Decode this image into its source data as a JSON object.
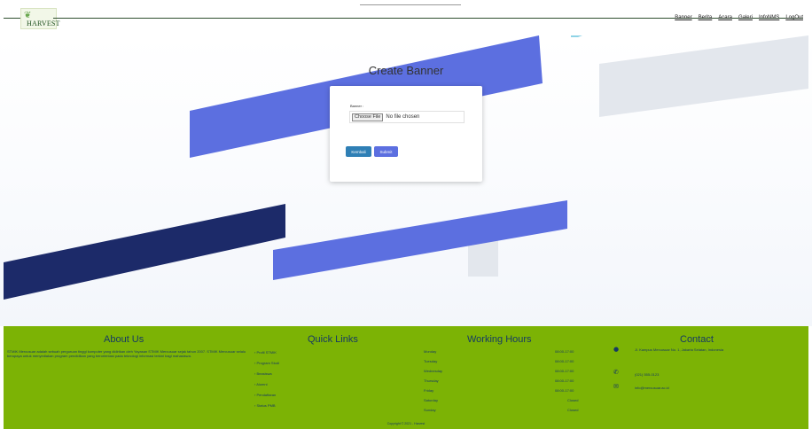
{
  "header": {
    "logo_text": "HARVEST",
    "nav": [
      "Banner",
      "Berita",
      "Acara",
      "Galeri",
      "InfoNMS",
      "LogOut"
    ]
  },
  "page": {
    "title": "Create Banner",
    "form": {
      "label": "Banner :",
      "choose_file_label": "Choose File",
      "file_status": "No file chosen",
      "buttons": [
        "Kembali",
        "Submit"
      ]
    }
  },
  "footer": {
    "about": {
      "title": "About Us",
      "text": "STMIK Mercusuar adalah sebuah perguruan tinggi komputer yang didirikan oleh Yayasan STMIK Mercusuar sejak tahun 2007. STMIK Mercusuar selalu berupaya untuk menyediakan program pendidikan yang berorientasi pada teknologi informasi terkini bagi mahasiswa."
    },
    "quick_links": {
      "title": "Quick Links",
      "items": [
        "Profil STMIK",
        "Program Studi",
        "Beasiswa",
        "Alumni",
        "Pendaftaran",
        "Status PMB"
      ]
    },
    "working_hours": {
      "title": "Working Hours",
      "rows": [
        {
          "day": "Monday",
          "time": "08:00-17:00"
        },
        {
          "day": "Tuesday",
          "time": "08:00-17:00"
        },
        {
          "day": "Wednesday",
          "time": "08:00-17:00"
        },
        {
          "day": "Thursday",
          "time": "08:00-17:00"
        },
        {
          "day": "Friday",
          "time": "08:00-17:00"
        },
        {
          "day": "Saturday",
          "time": "Closed"
        },
        {
          "day": "Sunday",
          "time": "Closed"
        }
      ]
    },
    "contact": {
      "title": "Contact",
      "address": "Jl. Kampus Mercusuar No. 1, Jakarta Selatan, Indonesia",
      "phone": "(021) 555-0123",
      "email": "info@mercusuar.ac.id"
    },
    "copyright": "Copyright © 2021 - Harvest"
  }
}
